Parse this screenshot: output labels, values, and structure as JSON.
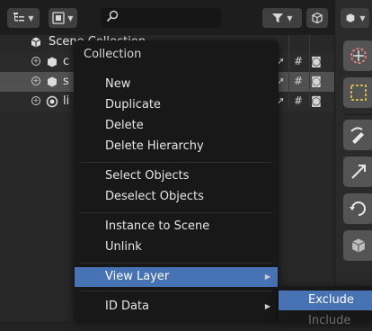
{
  "outliner": {
    "header": {
      "display_mode_icon": "outliner-display-mode-icon",
      "filter_icon": "funnel-icon",
      "new_collection_icon": "new-collection-icon",
      "search_placeholder": ""
    },
    "tree": {
      "root_label": "Scene Collection",
      "rows": [
        {
          "label": "c",
          "icon": "collection-icon"
        },
        {
          "label": "s",
          "icon": "collection-icon"
        },
        {
          "label": "li",
          "icon": "collection-icon"
        }
      ]
    }
  },
  "context_menu": {
    "title": "Collection",
    "groups": [
      [
        {
          "label": "New"
        },
        {
          "label": "Duplicate"
        },
        {
          "label": "Delete"
        },
        {
          "label": "Delete Hierarchy"
        }
      ],
      [
        {
          "label": "Select Objects"
        },
        {
          "label": "Deselect Objects"
        }
      ],
      [
        {
          "label": "Instance to Scene"
        },
        {
          "label": "Unlink"
        }
      ],
      [
        {
          "label": "View Layer",
          "submenu": true,
          "highlighted": true
        }
      ],
      [
        {
          "label": "ID Data",
          "submenu": true
        }
      ]
    ]
  },
  "submenu": {
    "items": [
      {
        "label": "Exclude",
        "highlighted": true
      },
      {
        "label": "Include",
        "disabled": true
      }
    ]
  },
  "colors": {
    "menu_highlight": "#4772b3",
    "menu_background": "#181818",
    "panel_background": "#282828"
  }
}
